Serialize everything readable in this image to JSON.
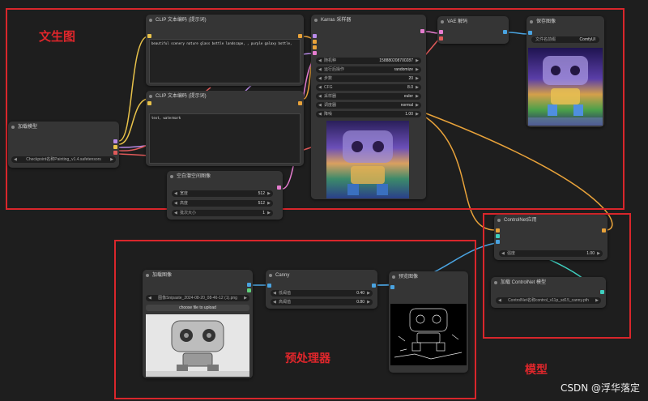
{
  "sections": {
    "txt2img": "文生图",
    "preprocessor": "预处理器",
    "model": "模型"
  },
  "nodes": {
    "clip_top": {
      "title": "CLIP 文本编码 (提示词)",
      "text": "beautiful scenery nature glass bottle landscape, , purple galaxy bottle,"
    },
    "clip_bottom": {
      "title": "CLIP 文本编码 (提示词)",
      "text": "text, watermark"
    },
    "load_model": {
      "title": "加载模型",
      "ckpt": "Checkpoint名称Painting_v1.4.safetensors"
    },
    "empty_latent": {
      "title": "空白潜空间图像",
      "w_lbl": "宽度",
      "w_val": "512",
      "h_lbl": "高度",
      "h_val": "512",
      "b_lbl": "批次大小",
      "b_val": "1"
    },
    "ksampler": {
      "title": "Karras 采样器",
      "rows": [
        {
          "lbl": "随机种",
          "val": "158880208700287"
        },
        {
          "lbl": "运行后操作",
          "val": "randomize"
        },
        {
          "lbl": "步数",
          "val": "20"
        },
        {
          "lbl": "CFG",
          "val": "8.0"
        },
        {
          "lbl": "采样器",
          "val": "euler"
        },
        {
          "lbl": "调度器",
          "val": "normal"
        },
        {
          "lbl": "降噪",
          "val": "1.00"
        }
      ]
    },
    "vae": {
      "title": "VAE 解码"
    },
    "save": {
      "title": "保存图像",
      "prefix_lbl": "文件名前缀",
      "prefix_val": "ComfyUI"
    },
    "controlnet_apply": {
      "title": "ControlNet应用",
      "lbl": "强度",
      "val": "1.00"
    },
    "controlnet_load": {
      "title": "加载 ControlNet 模型",
      "model": "ControlNet名称control_v11p_sd15_canny.pth"
    },
    "load_image": {
      "title": "加载图像",
      "file": "图像Snipaste_2024-08-20_08-46-12 (1).png",
      "upload": "choose file to upload"
    },
    "canny": {
      "title": "Canny",
      "lo_lbl": "低阈值",
      "lo_val": "0.40",
      "hi_lbl": "高阈值",
      "hi_val": "0.80"
    },
    "preview": {
      "title": "预览图像"
    }
  },
  "watermark": "CSDN @浮华落定"
}
